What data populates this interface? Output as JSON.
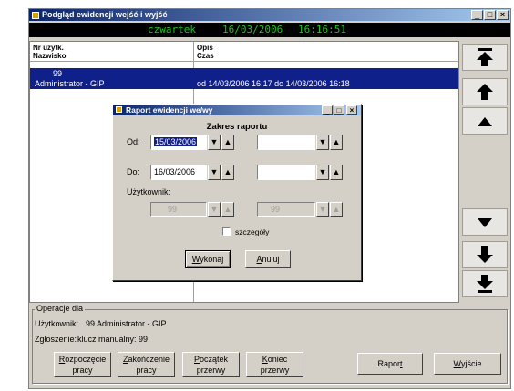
{
  "window": {
    "title": "Podgląd ewidencji wejść i wyjść"
  },
  "clock": {
    "day": "czwartek",
    "date": "16/03/2006",
    "time": "16:16:51"
  },
  "list": {
    "columns": {
      "col1_line1": "Nr użytk.",
      "col1_line2": "Nazwisko",
      "col2_line1": "Opis",
      "col2_line2": "Czas"
    },
    "rows": [
      {
        "id": "99",
        "name": "Administrator - GIP",
        "time": "od 14/03/2006 16:17 do 14/03/2006 16:18"
      }
    ]
  },
  "nav": [
    "top-icon",
    "page-up-icon",
    "up-icon",
    "down-icon",
    "page-down-icon",
    "bottom-icon"
  ],
  "dialog": {
    "title": "Raport ewidencji we/wy",
    "heading": "Zakres raportu",
    "from_label": "Od:",
    "from_value": "15/03/2006",
    "to_label": "Do:",
    "to_value": "16/03/2006",
    "user_label": "Użytkownik:",
    "user_from": "99",
    "user_to": "99",
    "details_label": "szczegóły",
    "ok": {
      "prefix": "",
      "key": "W",
      "rest": "ykonaj"
    },
    "cancel": {
      "prefix": "",
      "key": "A",
      "rest": "nuluj"
    }
  },
  "operations": {
    "group_label": "Operacje dla",
    "user_label": "Użytkownik:",
    "user_value": "99  Administrator - GIP",
    "report_label": "Zgłoszenie:",
    "report_value": "klucz manualny: 99"
  },
  "buttons": {
    "start_work": {
      "key": "R",
      "l1rest": "ozpoczęcie",
      "l2": "pracy"
    },
    "end_work": {
      "key": "Z",
      "l1rest": "akończenie",
      "l2": "pracy"
    },
    "break_start": {
      "key": "P",
      "l1rest": "oczątek",
      "l2": "przerwy"
    },
    "break_end": {
      "key": "K",
      "l1rest": "oniec",
      "l2": "przerwy"
    },
    "report": {
      "prefix": "Rapor",
      "key": "t",
      "rest": ""
    },
    "exit": {
      "prefix": "",
      "key": "W",
      "rest": "yjście"
    }
  },
  "colors": {
    "title_bar": "#0a246a",
    "selection": "#10208a",
    "clock_text": "#18c818",
    "clock_bg": "#000000",
    "face": "#d4d0c8"
  }
}
